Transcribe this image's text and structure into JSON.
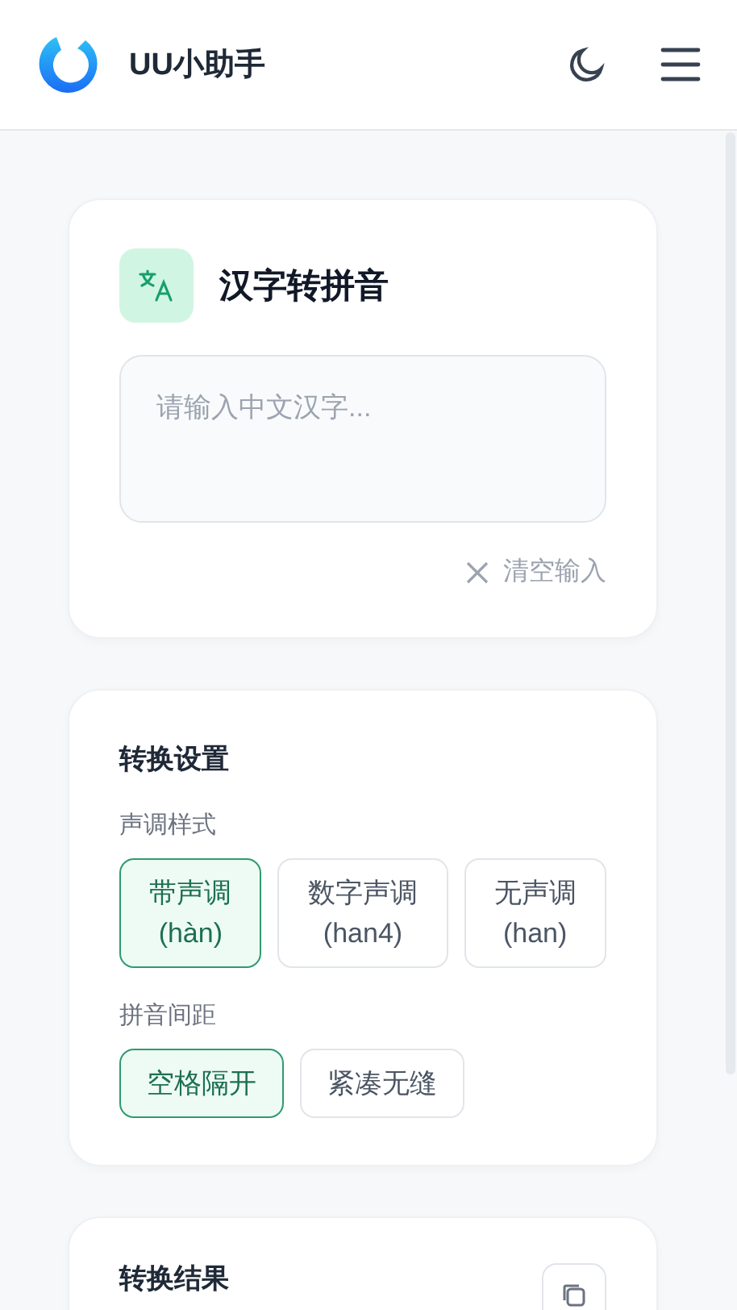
{
  "app": {
    "title": "UU小助手"
  },
  "input_card": {
    "title": "汉字转拼音",
    "input": {
      "placeholder": "请输入中文汉字..."
    },
    "clear_button": {
      "label": "清空输入"
    }
  },
  "settings": {
    "title": "转换设置",
    "groups": [
      {
        "label": "声调样式",
        "options": [
          {
            "label": "带声调",
            "example": "(hàn)",
            "selected": true
          },
          {
            "label": "数字声调",
            "example": "(han4)",
            "selected": false
          },
          {
            "label": "无声调",
            "example": "(han)",
            "selected": false
          }
        ]
      },
      {
        "label": "拼音间距",
        "options": [
          {
            "label": "空格隔开",
            "selected": true
          },
          {
            "label": "紧凑无缝",
            "selected": false
          }
        ]
      }
    ]
  },
  "result": {
    "title": "转换结果"
  }
}
